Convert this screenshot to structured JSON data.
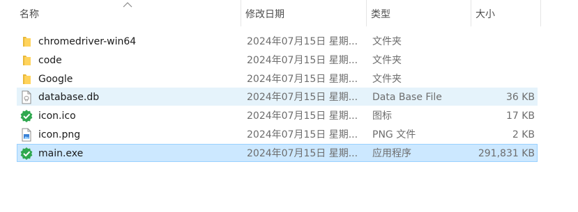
{
  "columns": {
    "name": "名称",
    "date": "修改日期",
    "type": "类型",
    "size": "大小"
  },
  "files": [
    {
      "name": "chromedriver-win64",
      "date": "2024年07月15日 星期...",
      "type": "文件夹",
      "size": "",
      "icon": "folder-icon"
    },
    {
      "name": "code",
      "date": "2024年07月15日 星期...",
      "type": "文件夹",
      "size": "",
      "icon": "folder-icon"
    },
    {
      "name": "Google",
      "date": "2024年07月15日 星期...",
      "type": "文件夹",
      "size": "",
      "icon": "folder-icon"
    },
    {
      "name": "database.db",
      "date": "2024年07月15日 星期...",
      "type": "Data Base File",
      "size": "36 KB",
      "icon": "database-file-icon"
    },
    {
      "name": "icon.ico",
      "date": "2024年07月15日 星期...",
      "type": "图标",
      "size": "17 KB",
      "icon": "green-check-icon"
    },
    {
      "name": "icon.png",
      "date": "2024年07月15日 星期...",
      "type": "PNG 文件",
      "size": "2 KB",
      "icon": "image-file-icon"
    },
    {
      "name": "main.exe",
      "date": "2024年07月15日 星期...",
      "type": "应用程序",
      "size": "291,831 KB",
      "icon": "green-check-icon"
    }
  ],
  "colors": {
    "folder": "#ffd35c",
    "hover_row": "#e5f3fb",
    "selected_row": "#cce8ff",
    "selected_border": "#99d1ff",
    "check_green": "#2fa84f"
  }
}
